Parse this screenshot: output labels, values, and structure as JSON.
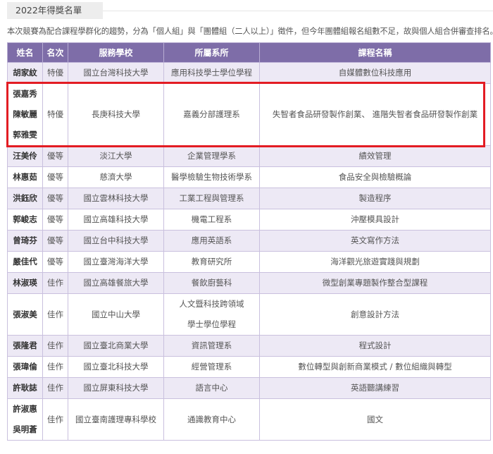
{
  "section": {
    "heading": "2022年得獎名單",
    "intro": "本次競賽為配合課程學群化的趨勢，分為「個人組」與「團體組（二人以上）」徵件，但今年團體組報名組數不足，故與個人組合併審查排名。"
  },
  "table": {
    "headers": [
      "姓名",
      "名次",
      "服務學校",
      "所屬系所",
      "課程名稱"
    ],
    "rows": [
      {
        "names": [
          "胡家紋"
        ],
        "rank": "特優",
        "school": "國立台灣科技大學",
        "dept": [
          "應用科技學士學位學程"
        ],
        "course": "自媒體數位科技應用",
        "highlight": false
      },
      {
        "names": [
          "張嘉秀",
          "陳敏麗",
          "郭雅雯"
        ],
        "rank": "特優",
        "school": "長庚科技大學",
        "dept": [
          "嘉義分部護理系"
        ],
        "course": "失智者食品研發製作創業、 進階失智者食品研發製作創業",
        "highlight": true
      },
      {
        "names": [
          "汪美伶"
        ],
        "rank": "優等",
        "school": "淡江大學",
        "dept": [
          "企業管理學系"
        ],
        "course": "績效管理",
        "highlight": false
      },
      {
        "names": [
          "林惠茹"
        ],
        "rank": "優等",
        "school": "慈濟大學",
        "dept": [
          "醫學檢驗生物技術學系"
        ],
        "course": "食品安全與檢驗概論",
        "highlight": false
      },
      {
        "names": [
          "洪鈺欣"
        ],
        "rank": "優等",
        "school": "國立雲林科技大學",
        "dept": [
          "工業工程與管理系"
        ],
        "course": "製造程序",
        "highlight": false
      },
      {
        "names": [
          "郭峻志"
        ],
        "rank": "優等",
        "school": "國立高雄科技大學",
        "dept": [
          "機電工程系"
        ],
        "course": "沖壓模具設計",
        "highlight": false
      },
      {
        "names": [
          "曾琦芬"
        ],
        "rank": "優等",
        "school": "國立台中科技大學",
        "dept": [
          "應用英語系"
        ],
        "course": "英文寫作方法",
        "highlight": false
      },
      {
        "names": [
          "嚴佳代"
        ],
        "rank": "優等",
        "school": "國立臺灣海洋大學",
        "dept": [
          "教育研究所"
        ],
        "course": "海洋觀光旅遊實踐與規劃",
        "highlight": false
      },
      {
        "names": [
          "林淑瑛"
        ],
        "rank": "佳作",
        "school": "國立高雄餐旅大學",
        "dept": [
          "餐飲廚藝科"
        ],
        "course": "微型創業專題製作整合型課程",
        "highlight": false
      },
      {
        "names": [
          "張淑美"
        ],
        "rank": "佳作",
        "school": "國立中山大學",
        "dept": [
          "人文暨科技跨領域",
          "學士學位學程"
        ],
        "course": "創意設計方法",
        "highlight": false
      },
      {
        "names": [
          "張隆君"
        ],
        "rank": "佳作",
        "school": "國立臺北商業大學",
        "dept": [
          "資訊管理系"
        ],
        "course": "程式設計",
        "highlight": false
      },
      {
        "names": [
          "張瑋倫"
        ],
        "rank": "佳作",
        "school": "國立臺北科技大學",
        "dept": [
          "經營管理系"
        ],
        "course": "數位轉型與創新商業模式 / 數位組織與轉型",
        "highlight": false
      },
      {
        "names": [
          "許耿誌"
        ],
        "rank": "佳作",
        "school": "國立屏東科技大學",
        "dept": [
          "語言中心"
        ],
        "course": "英語聽講練習",
        "highlight": false
      },
      {
        "names": [
          "許淑惠",
          "吳明蒼"
        ],
        "rank": "佳作",
        "school": "國立臺南護理專科學校",
        "dept": [
          "通識教育中心"
        ],
        "course": "國文",
        "highlight": false
      }
    ]
  },
  "colors": {
    "header_bg": "#7e6da8",
    "stripe_bg": "#ede9f5",
    "highlight_border": "#e31c23"
  }
}
